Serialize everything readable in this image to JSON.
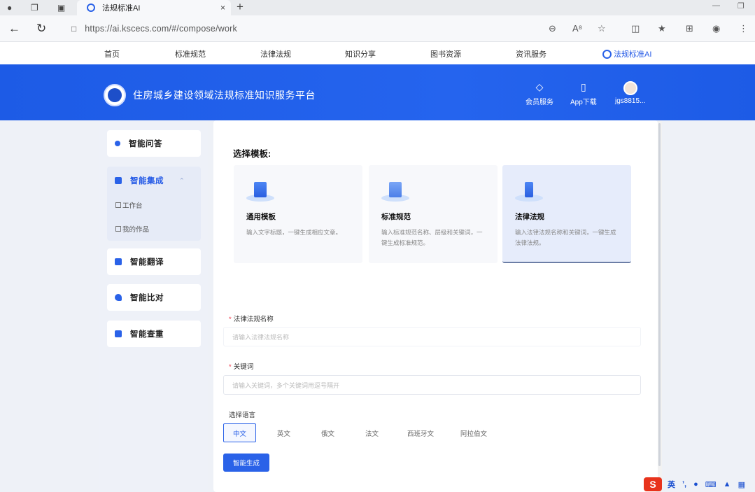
{
  "browser": {
    "tab_title": "法规标准AI",
    "tab_close": "×",
    "new_tab": "+",
    "url": "https://ai.kscecs.com/#/compose/work"
  },
  "sitenav": {
    "items": [
      "首页",
      "标准规范",
      "法律法规",
      "知识分享",
      "图书资源",
      "资讯服务"
    ],
    "ai_label": "法规标准AI"
  },
  "header": {
    "site_title": "住房城乡建设领域法规标准知识服务平台",
    "member_label": "会员服务",
    "app_label": "App下载",
    "user_label": "jgs8815..."
  },
  "sidebar": {
    "qa": "智能问答",
    "integration": "智能集成",
    "sub_workbench": "工作台",
    "sub_works": "我的作品",
    "translate": "智能翻译",
    "compare": "智能比对",
    "check": "智能查重"
  },
  "main": {
    "choose_template": "选择模板:",
    "templates": [
      {
        "name": "通用模板",
        "desc": "输入文字标题，一键生成相应文章。"
      },
      {
        "name": "标准规范",
        "desc": "输入标准规范名称、层级和关键词，一键生成标准规范。"
      },
      {
        "name": "法律法规",
        "desc": "输入法律法规名称和关键词，一键生成法律法规。"
      }
    ],
    "law_name_label": "法律法规名称",
    "law_name_placeholder": "请输入法律法规名称",
    "keyword_label": "关键词",
    "keyword_placeholder": "请输入关键词，多个关键词用逗号隔开",
    "language_label": "选择语言",
    "languages": [
      "中文",
      "英文",
      "俄文",
      "法文",
      "西班牙文",
      "阿拉伯文"
    ],
    "selected_language": "中文",
    "generate_button": "智能生成"
  },
  "ime": {
    "logo": "S",
    "mode": "英"
  }
}
